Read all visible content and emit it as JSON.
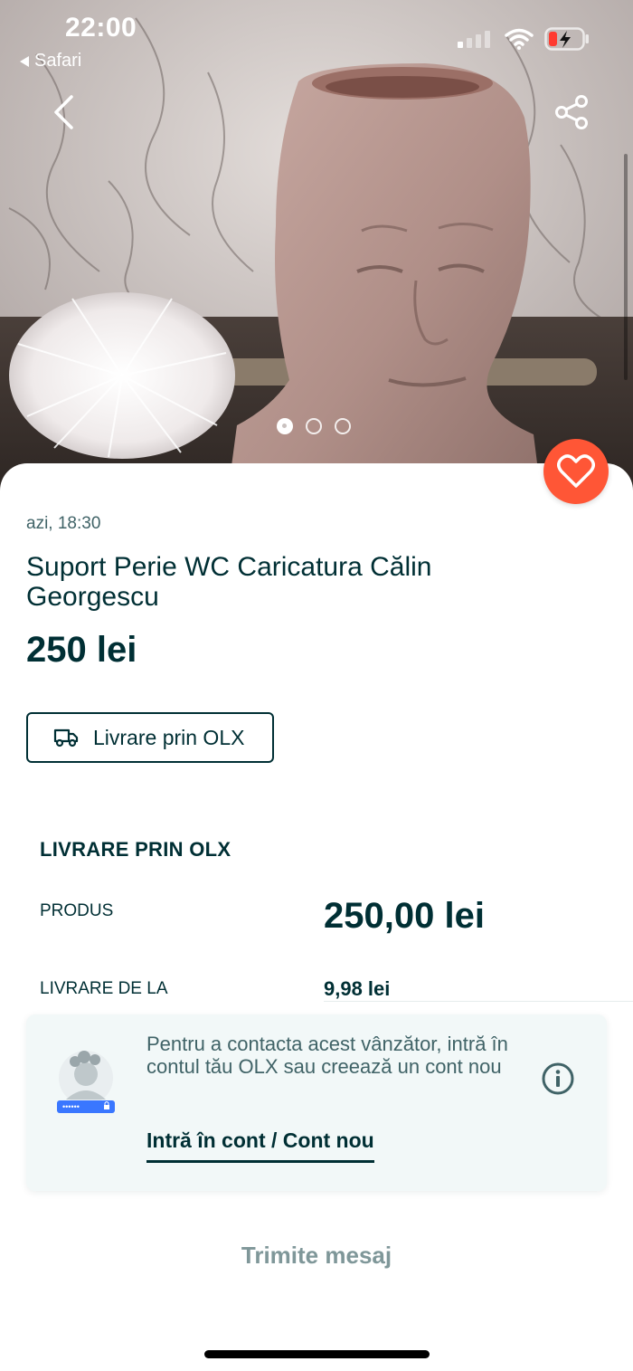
{
  "status_bar": {
    "time": "22:00",
    "back_app": "Safari",
    "battery_color": "#ff3b30"
  },
  "gallery": {
    "total_images": 3,
    "active_index": 0
  },
  "listing": {
    "posted": "azi, 18:30",
    "title": "Suport Perie WC Caricatura Călin Georgescu",
    "price": "250 lei",
    "delivery_button": "Livrare prin OLX"
  },
  "delivery_section": {
    "title": "LIVRARE PRIN OLX",
    "product_label": "PRODUS",
    "product_value": "250,00 lei",
    "shipping_label": "LIVRARE DE LA",
    "shipping_value": "9,98 lei"
  },
  "login_card": {
    "text": "Pentru a contacta acest vânzător, intră în contul tău OLX sau creează un cont nou",
    "link": "Intră în cont / Cont nou",
    "password_dots": "••••••"
  },
  "actions": {
    "send_message": "Trimite mesaj"
  },
  "colors": {
    "brand_dark": "#002f34",
    "favorite_bg": "#ff5636",
    "muted": "#7f9799"
  }
}
